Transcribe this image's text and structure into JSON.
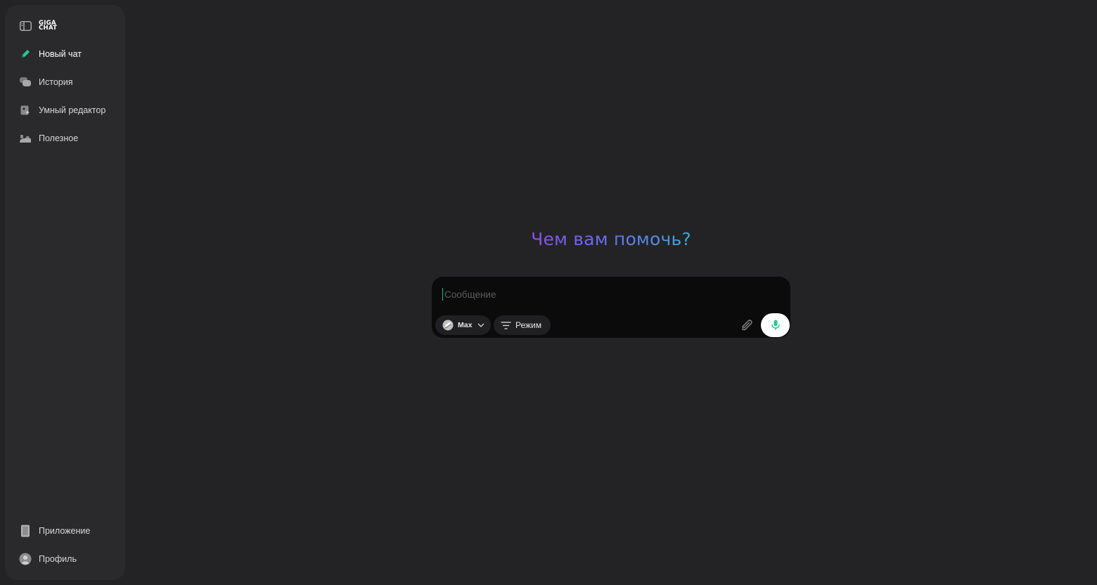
{
  "sidebar": {
    "logo": {
      "line1": "GIGA",
      "line2": "CHAT"
    },
    "items": [
      {
        "label": "Новый чат",
        "icon": "new-chat-icon"
      },
      {
        "label": "История",
        "icon": "history-icon"
      },
      {
        "label": "Умный редактор",
        "icon": "smart-editor-icon"
      },
      {
        "label": "Полезное",
        "icon": "useful-icon"
      }
    ],
    "bottom_items": [
      {
        "label": "Приложение",
        "icon": "phone-icon"
      },
      {
        "label": "Профиль",
        "icon": "profile-icon"
      }
    ]
  },
  "main": {
    "greeting": "Чем вам помочь?",
    "composer": {
      "placeholder": "Сообщение",
      "value": "",
      "model_label": "Max",
      "mode_label": "Режим"
    }
  },
  "colors": {
    "background": "#232325",
    "sidebar": "#2a2a2c",
    "composer": "#0b0b0b",
    "accent": "#1ec08a",
    "greeting_gradient_start": "#8a4fe4",
    "greeting_gradient_end": "#3fa6d8"
  }
}
